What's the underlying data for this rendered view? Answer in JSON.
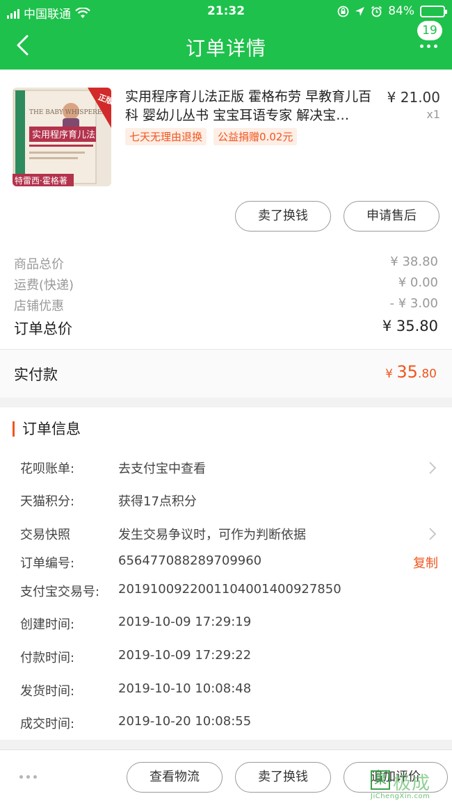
{
  "status_bar": {
    "carrier": "中国联通",
    "time": "21:32",
    "battery": "84%",
    "battery_level": 0.84
  },
  "nav": {
    "title": "订单详情",
    "badge": "19"
  },
  "product": {
    "cover_text": {
      "series": "THE BABY WHISPERER",
      "title": "实用程序育儿法",
      "stamp": "正版包邮",
      "author": "特雷西·霍格著"
    },
    "title": "实用程序育儿法正版 霍格布劳 早教育儿百科 婴幼儿丛书 宝宝耳语专家 解决宝…",
    "price": "¥ 21.00",
    "quantity": "x1",
    "tags": [
      "七天无理由退换",
      "公益捐赠0.02元"
    ]
  },
  "item_actions": {
    "sell": "卖了换钱",
    "after_sale": "申请售后"
  },
  "fees": [
    {
      "label": "商品总价",
      "value": "¥ 38.80"
    },
    {
      "label": "运费(快递)",
      "value": "¥ 0.00"
    },
    {
      "label": "店铺优惠",
      "value": "- ¥ 3.00"
    }
  ],
  "total": {
    "label": "订单总价",
    "value": "¥ 35.80"
  },
  "paid": {
    "label": "实付款",
    "currency": "¥",
    "integer": "35",
    "decimal": ".80"
  },
  "order_info": {
    "title": "订单信息",
    "rows": [
      {
        "label": "花呗账单:",
        "value": "去支付宝中查看"
      },
      {
        "label": "天猫积分:",
        "value": "获得17点积分"
      },
      {
        "label": "交易快照",
        "value": "发生交易争议时，可作为判断依据"
      },
      {
        "label": "订单编号:",
        "value": "656477088289709960",
        "action": "复制"
      },
      {
        "label": "支付宝交易号:",
        "value": "2019100922001104001400927850"
      },
      {
        "label": "创建时间:",
        "value": "2019-10-09 17:29:19"
      },
      {
        "label": "付款时间:",
        "value": "2019-10-09 17:29:22"
      },
      {
        "label": "发货时间:",
        "value": "2019-10-10 10:08:48"
      },
      {
        "label": "成交时间:",
        "value": "2019-10-20 10:08:55"
      }
    ]
  },
  "bottom_bar": {
    "logistics": "查看物流",
    "sell": "卖了换钱",
    "review": "追加评价"
  },
  "watermark": {
    "icon": "果",
    "name": "极成",
    "site": "JiChengXin.com"
  },
  "colors": {
    "header": "#1ec14b",
    "accent": "#f0561f"
  }
}
